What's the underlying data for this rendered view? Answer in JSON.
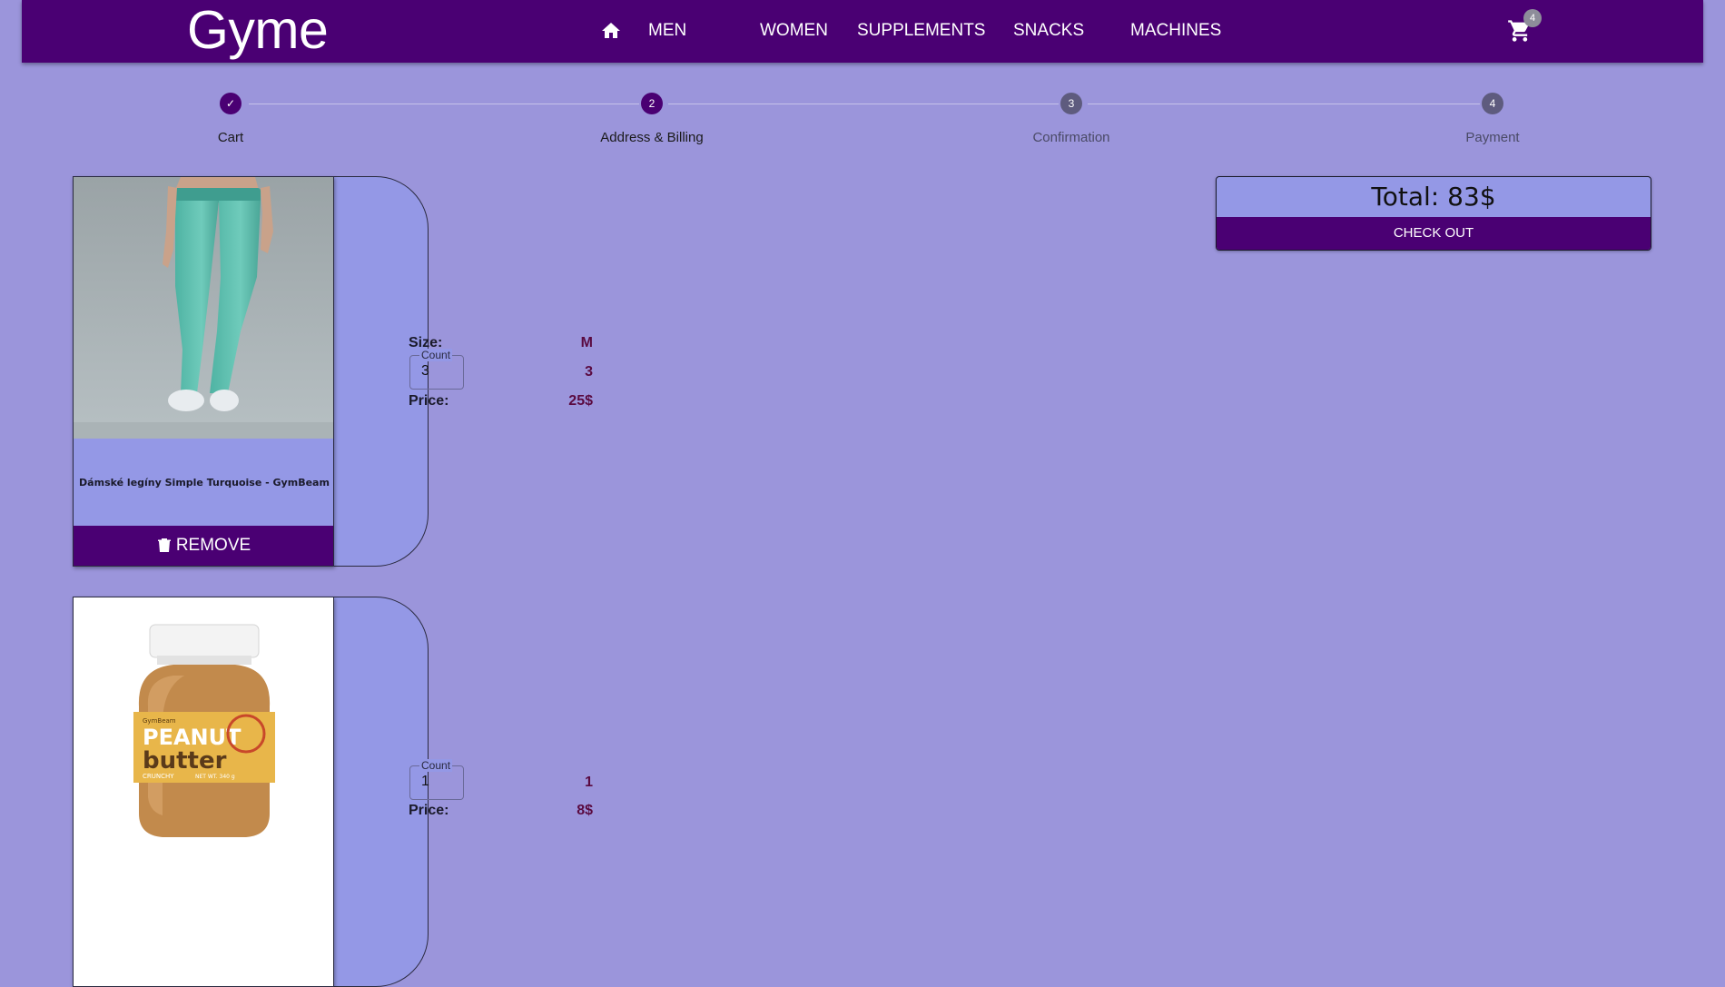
{
  "header": {
    "logo": "Gyme",
    "nav": [
      "MEN",
      "WOMEN",
      "SUPPLEMENTS",
      "SNACKS",
      "MACHINES"
    ],
    "cart_count": "4",
    "icons": [
      "home-icon",
      "cart-icon"
    ]
  },
  "stepper": {
    "steps": [
      {
        "label": "Cart",
        "marker": "✓",
        "state": "completed"
      },
      {
        "label": "Address & Billing",
        "marker": "2",
        "state": "active"
      },
      {
        "label": "Confirmation",
        "marker": "3",
        "state": "pending"
      },
      {
        "label": "Payment",
        "marker": "4",
        "state": "pending"
      }
    ]
  },
  "cart": {
    "items": [
      {
        "name": "Dámské legíny Simple Turquoise - GymBeam",
        "size_label": "Size:",
        "size": "M",
        "count_label": "Count",
        "count": "3",
        "count_display": "3",
        "price_label": "Price:",
        "price": "25$",
        "remove_label": "REMOVE"
      },
      {
        "count_label": "Count",
        "count": "1",
        "count_display": "1",
        "price_label": "Price:",
        "price": "8$",
        "jar_brand": "GymBeam",
        "jar_title_1": "PEANUT",
        "jar_title_2": "butter",
        "jar_variant": "CRUNCHY",
        "jar_weight": "NET WT. 340 g"
      }
    ]
  },
  "summary": {
    "total": "Total: 83$",
    "checkout_label": "CHECK OUT"
  },
  "colors": {
    "background": "#9b95db",
    "primary": "#4a0073",
    "card": "#9498e6",
    "price": "#5a0a40"
  }
}
